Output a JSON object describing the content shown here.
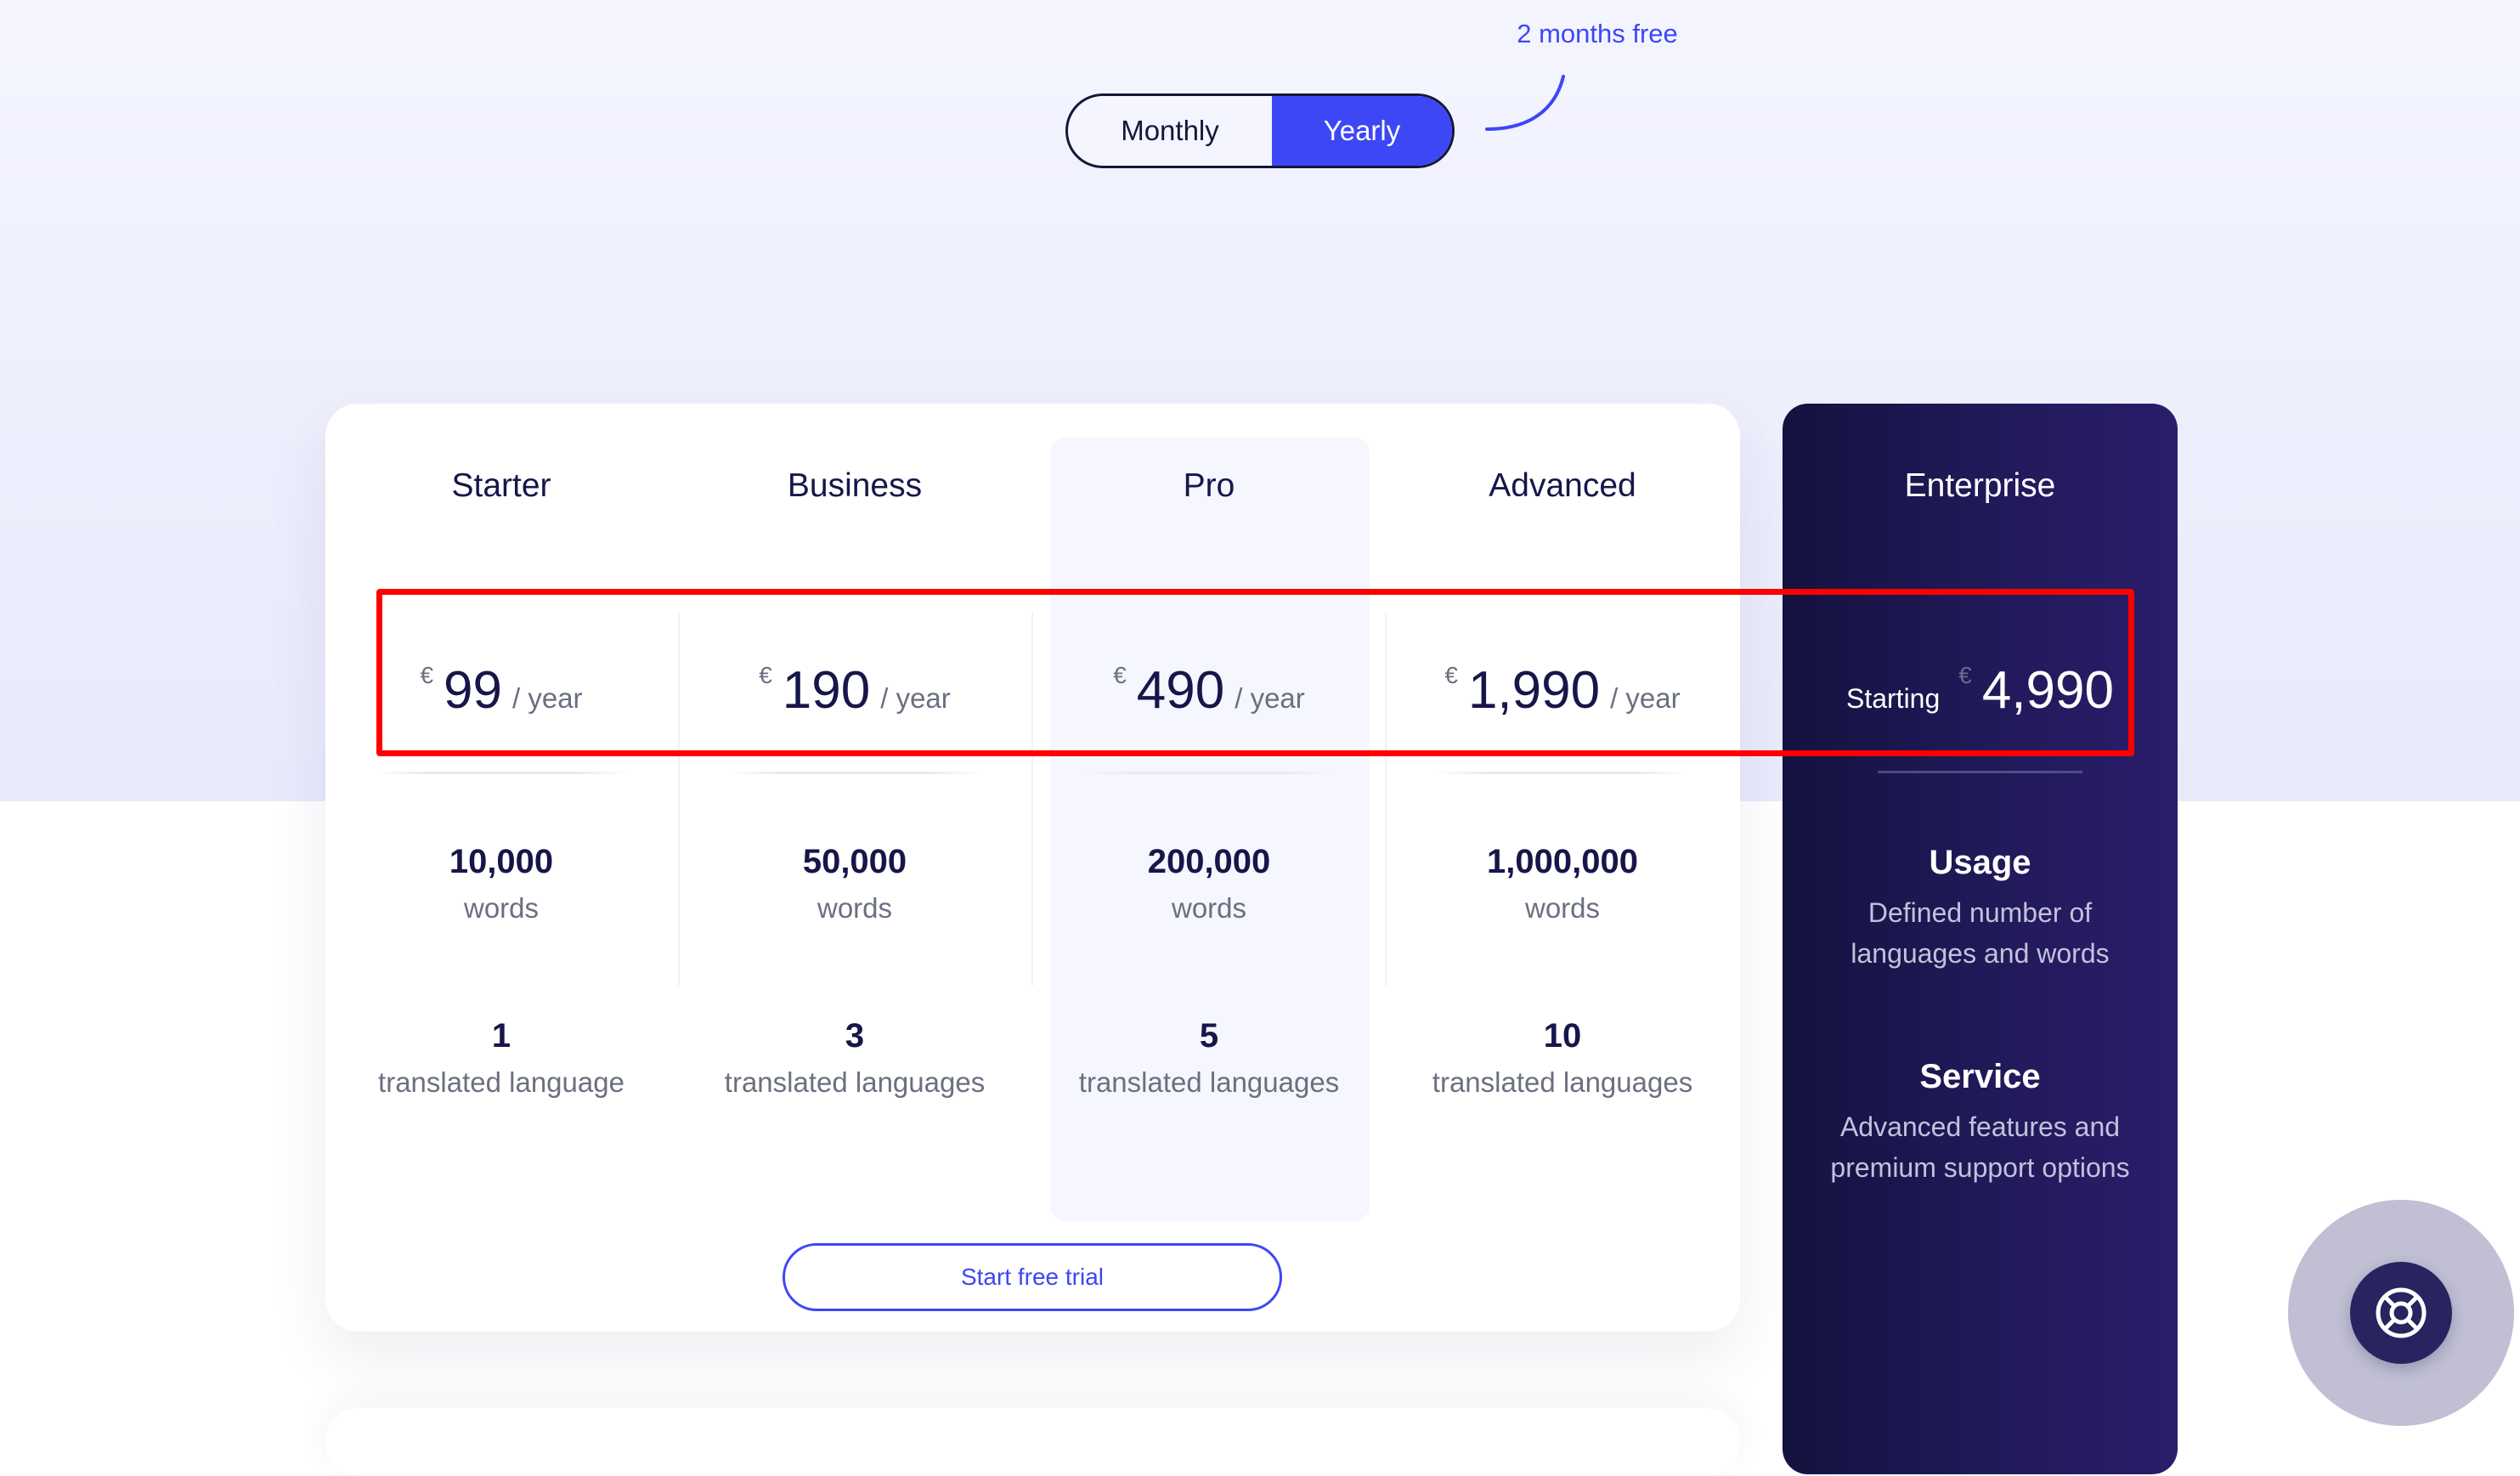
{
  "billing_toggle": {
    "options": [
      "Monthly",
      "Yearly"
    ],
    "selected": "Yearly"
  },
  "promo_note": "2 months free",
  "plans": [
    {
      "name": "Starter",
      "currency": "€",
      "price": "99",
      "period": "/ year",
      "words": "10,000",
      "words_label": "words",
      "languages": "1",
      "languages_label": "translated language"
    },
    {
      "name": "Business",
      "currency": "€",
      "price": "190",
      "period": "/ year",
      "words": "50,000",
      "words_label": "words",
      "languages": "3",
      "languages_label": "translated languages"
    },
    {
      "name": "Pro",
      "currency": "€",
      "price": "490",
      "period": "/ year",
      "words": "200,000",
      "words_label": "words",
      "languages": "5",
      "languages_label": "translated languages",
      "highlighted": true
    },
    {
      "name": "Advanced",
      "currency": "€",
      "price": "1,990",
      "period": "/ year",
      "words": "1,000,000",
      "words_label": "words",
      "languages": "10",
      "languages_label": "translated languages"
    }
  ],
  "cta": {
    "label": "Start free trial"
  },
  "enterprise": {
    "name": "Enterprise",
    "starting_label": "Starting",
    "currency": "€",
    "price": "4,990",
    "features": [
      {
        "title": "Usage",
        "description": "Defined number of languages and words"
      },
      {
        "title": "Service",
        "description": "Advanced features and premium support options"
      }
    ]
  },
  "help_button": {
    "icon": "lifebuoy-icon"
  },
  "colors": {
    "accent": "#3d47f5",
    "text_dark": "#17164a",
    "text_muted": "#6b7080",
    "enterprise_bg": "#211a5a",
    "highlight_annotation": "#ff0000"
  }
}
